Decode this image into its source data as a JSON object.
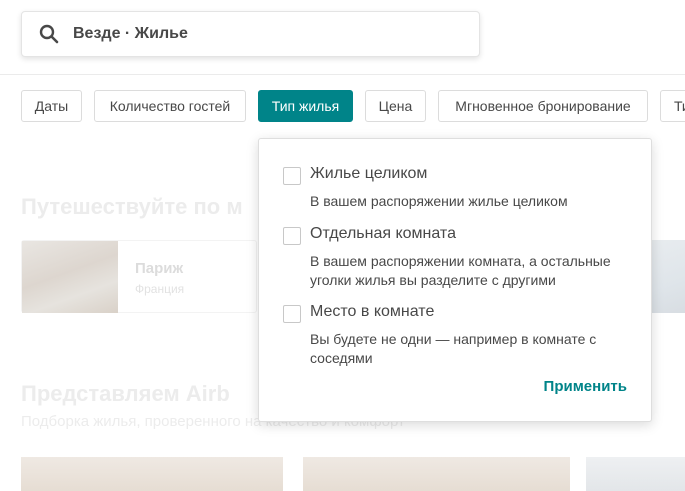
{
  "search": {
    "text": "Везде · Жилье"
  },
  "filters": [
    {
      "label": "Даты"
    },
    {
      "label": "Количество гостей"
    },
    {
      "label": "Тип жилья"
    },
    {
      "label": "Цена"
    },
    {
      "label": "Мгновенное бронирование"
    },
    {
      "label": "Ти"
    }
  ],
  "background": {
    "section1_title": "Путешествуйте по м",
    "card": {
      "city": "Париж",
      "country": "Франция"
    },
    "section2_title": "Представляем Airb",
    "section2_subtitle": "Подборка жилья, проверенного на качество и комфорт"
  },
  "dropdown": {
    "options": [
      {
        "label": "Жилье целиком",
        "description": "В вашем распоряжении жилье целиком"
      },
      {
        "label": "Отдельная комната",
        "description": "В вашем распоряжении комната, а остальные уголки жилья вы разделите с другими"
      },
      {
        "label": "Место в комнате",
        "description": "Вы будете не одни — например в комнате с соседями"
      }
    ],
    "apply_label": "Применить"
  },
  "colors": {
    "accent": "#008489",
    "text": "#484848"
  }
}
